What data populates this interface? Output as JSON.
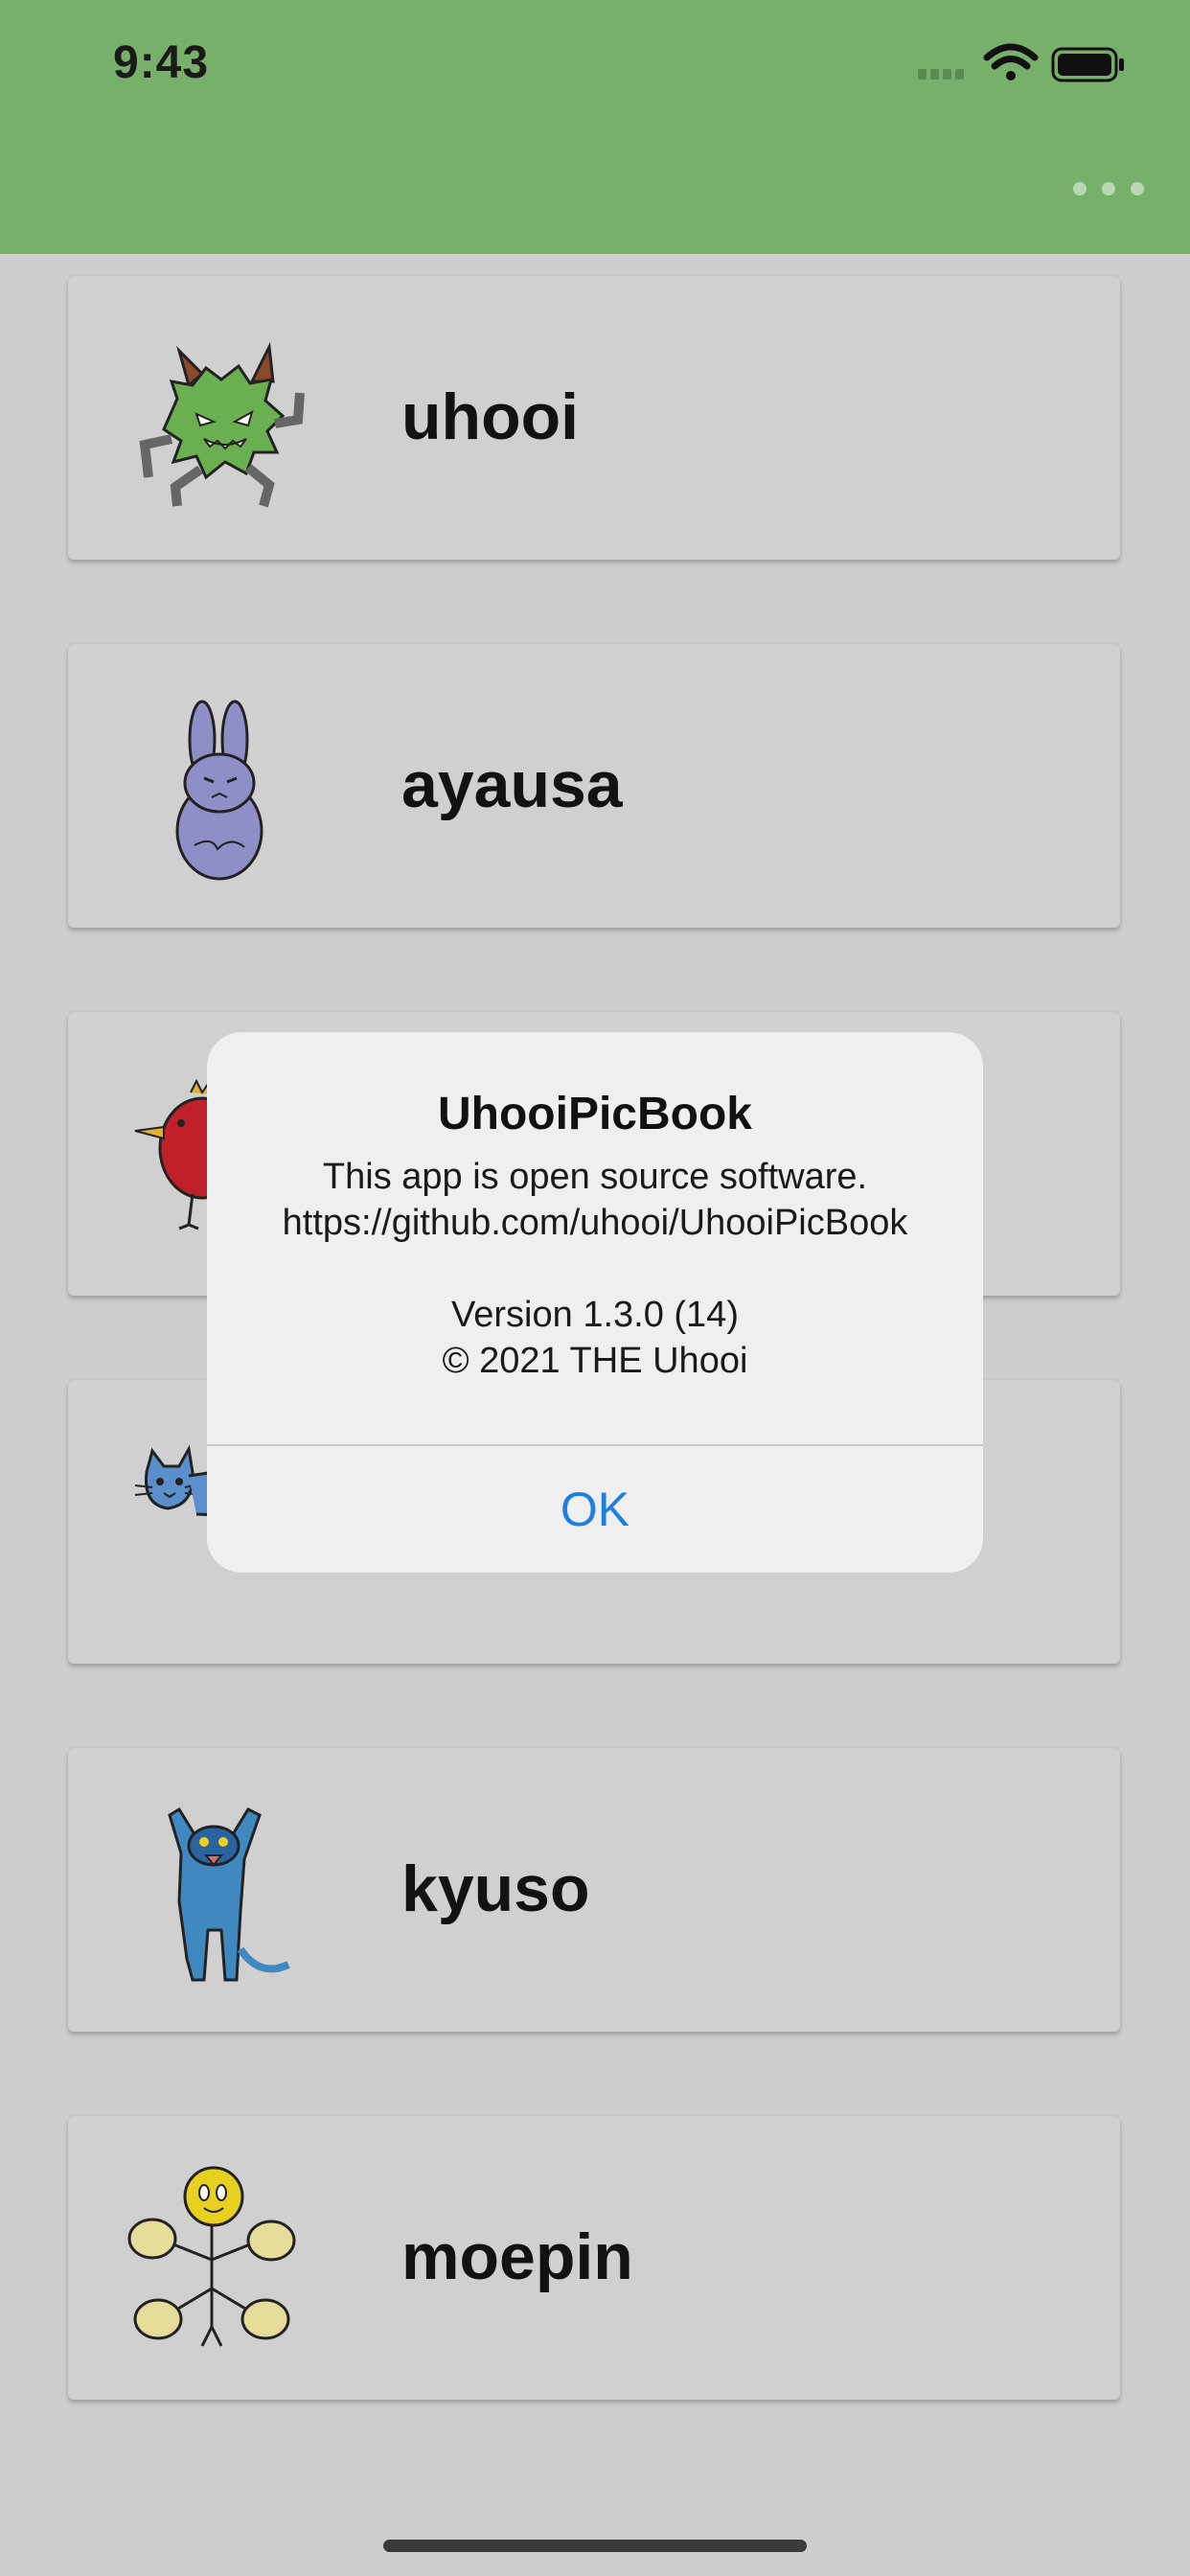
{
  "status_bar": {
    "time": "9:43",
    "icons": [
      "cellular-signal-icon",
      "wifi-icon",
      "battery-icon"
    ]
  },
  "navbar": {
    "more_icon": "ellipsis-icon",
    "color": "#76b06a"
  },
  "characters": [
    {
      "name": "uhooi",
      "image": "green-monster-illustration"
    },
    {
      "name": "ayausa",
      "image": "purple-rabbit-illustration"
    },
    {
      "name": "",
      "image": "red-bird-illustration"
    },
    {
      "name": "",
      "image": "blue-cat-illustration"
    },
    {
      "name": "kyuso",
      "image": "blue-mouse-illustration"
    },
    {
      "name": "moepin",
      "image": "yellow-flower-illustration"
    }
  ],
  "alert": {
    "title": "UhooiPicBook",
    "line1": "This app is open source software.",
    "line2": "https://github.com/uhooi/UhooiPicBook",
    "line3": "Version 1.3.0 (14)",
    "line4": "© 2021 THE Uhooi",
    "ok_label": "OK",
    "accent_color": "#1d7fe0"
  }
}
